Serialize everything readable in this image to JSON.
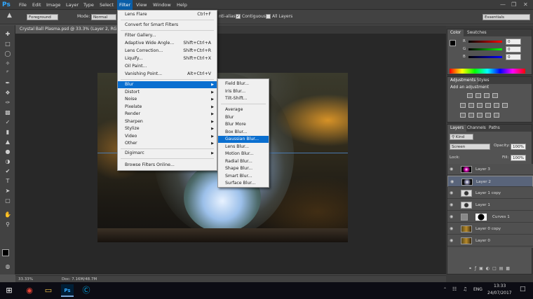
{
  "app": {
    "logo": "Ps"
  },
  "menubar": {
    "items": [
      "File",
      "Edit",
      "Image",
      "Layer",
      "Type",
      "Select",
      "Filter",
      "View",
      "Window",
      "Help"
    ],
    "active": "Filter"
  },
  "options": {
    "sample_select": "Foreground",
    "mode_label": "Mode:",
    "mode_value": "Normal",
    "anti_alias_label": "nti-alias",
    "contiguous_label": "Contiguous",
    "all_layers_label": "All Layers",
    "workspace": "Essentials"
  },
  "document": {
    "tab_title": "Crystal Ball Plasma.psd @ 33.3% (Layer 2, RGB/8"
  },
  "status": {
    "zoom": "33.33%",
    "doc": "Doc: 7.16M/48.7M"
  },
  "filter_menu": {
    "items": [
      {
        "label": "Lens Flare",
        "shortcut": "Ctrl+F"
      },
      {
        "label": "Convert for Smart Filters",
        "shortcut": ""
      },
      {
        "label": "Filter Gallery...",
        "shortcut": ""
      },
      {
        "label": "Adaptive Wide Angle...",
        "shortcut": "Shift+Ctrl+A"
      },
      {
        "label": "Lens Correction...",
        "shortcut": "Shift+Ctrl+R"
      },
      {
        "label": "Liquify...",
        "shortcut": "Shift+Ctrl+X"
      },
      {
        "label": "Oil Paint...",
        "shortcut": ""
      },
      {
        "label": "Vanishing Point...",
        "shortcut": "Alt+Ctrl+V"
      },
      {
        "label": "Blur",
        "shortcut": ""
      },
      {
        "label": "Distort",
        "shortcut": ""
      },
      {
        "label": "Noise",
        "shortcut": ""
      },
      {
        "label": "Pixelate",
        "shortcut": ""
      },
      {
        "label": "Render",
        "shortcut": ""
      },
      {
        "label": "Sharpen",
        "shortcut": ""
      },
      {
        "label": "Stylize",
        "shortcut": ""
      },
      {
        "label": "Video",
        "shortcut": ""
      },
      {
        "label": "Other",
        "shortcut": ""
      },
      {
        "label": "Digimarc",
        "shortcut": ""
      },
      {
        "label": "Browse Filters Online...",
        "shortcut": ""
      }
    ]
  },
  "blur_menu": {
    "items": [
      "Field Blur...",
      "Iris Blur...",
      "Tilt-Shift...",
      "Average",
      "Blur",
      "Blur More",
      "Box Blur...",
      "Gaussian Blur...",
      "Lens Blur...",
      "Motion Blur...",
      "Radial Blur...",
      "Shape Blur...",
      "Smart Blur...",
      "Surface Blur..."
    ],
    "highlighted": "Gaussian Blur..."
  },
  "color_panel": {
    "tabs": [
      "Color",
      "Swatches"
    ],
    "r": "0",
    "g": "0",
    "b": "0",
    "r_label": "R",
    "g_label": "G",
    "b_label": "B"
  },
  "adjustments_panel": {
    "tabs": [
      "Adjustments",
      "Styles"
    ],
    "heading": "Add an adjustment"
  },
  "layers_panel": {
    "tabs": [
      "Layers",
      "Channels",
      "Paths"
    ],
    "filter_kind": "Kind",
    "blend_mode": "Screen",
    "opacity_label": "Opacity:",
    "opacity": "100%",
    "lock_label": "Lock:",
    "fill_label": "Fill:",
    "fill": "100%",
    "layers": [
      "Layer 3",
      "Layer 2",
      "Layer 1 copy",
      "Layer 1",
      "Curves 1",
      "Layer 0 copy",
      "Layer 0"
    ],
    "selected": "Layer 2"
  },
  "taskbar": {
    "lang": "ENG",
    "time": "13:33",
    "date": "24/07/2017"
  },
  "colors": {
    "accent": "#0a6fd0",
    "ps_blue": "#31a8ff"
  }
}
